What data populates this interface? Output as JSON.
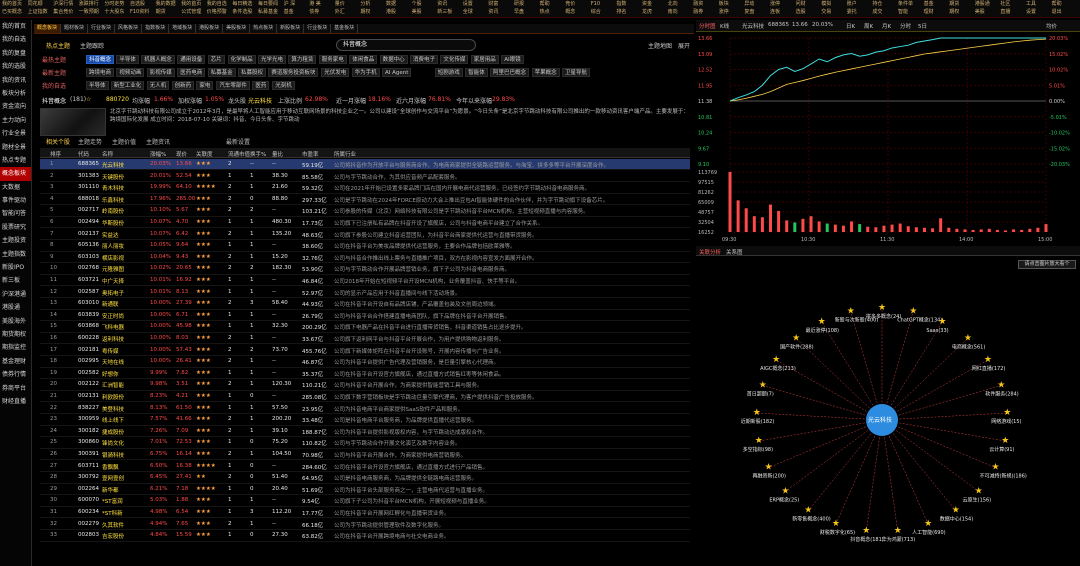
{
  "menu_items": [
    {
      "a": "我的首页",
      "b": "已买概念"
    },
    {
      "a": "同花顺",
      "b": "上证指数"
    },
    {
      "a": "沪深行情",
      "b": "集合竞价"
    },
    {
      "a": "涨跌排行",
      "b": "一致预期"
    },
    {
      "a": "分时走势",
      "b": "十大股东"
    },
    {
      "a": "自选股",
      "b": "F10资料"
    },
    {
      "a": "我的数据",
      "b": "期货"
    },
    {
      "a": "我的首页",
      "b": "公式管理"
    },
    {
      "a": "我的自选",
      "b": "价格预警"
    },
    {
      "a": "每日精选",
      "b": "条件选股"
    },
    {
      "a": "每日要闻",
      "b": "私募基金"
    },
    {
      "a": "沪 深",
      "b": "基金"
    },
    {
      "a": "港 美",
      "b": "债券"
    },
    {
      "a": "量价",
      "b": "外汇"
    },
    {
      "a": "分析",
      "b": "期权"
    },
    {
      "a": "数据",
      "b": "港股"
    },
    {
      "a": "个股",
      "b": "美股"
    },
    {
      "a": "资讯",
      "b": "新三板"
    },
    {
      "a": "设置",
      "b": "全球"
    },
    {
      "a": "财富",
      "b": "资讯"
    },
    {
      "a": "研报",
      "b": "早盘"
    },
    {
      "a": "帮助",
      "b": "热点"
    },
    {
      "a": "竞价",
      "b": "概念"
    },
    {
      "a": "F10",
      "b": "综合"
    },
    {
      "a": "指数",
      "b": "排名"
    },
    {
      "a": "资金",
      "b": "龙虎"
    },
    {
      "a": "北向",
      "b": "南向"
    },
    {
      "a": "融资",
      "b": "融券"
    },
    {
      "a": "板块",
      "b": "涨停"
    },
    {
      "a": "异动",
      "b": "复盘"
    },
    {
      "a": "涨停",
      "b": "连板"
    },
    {
      "a": "问财",
      "b": "选股"
    },
    {
      "a": "模拟",
      "b": "交易"
    },
    {
      "a": "账户",
      "b": "委托"
    },
    {
      "a": "持仓",
      "b": "成交"
    },
    {
      "a": "条件单",
      "b": "智能"
    },
    {
      "a": "基金",
      "b": "理财"
    },
    {
      "a": "期货",
      "b": "期权"
    },
    {
      "a": "港股通",
      "b": "美股"
    },
    {
      "a": "社区",
      "b": "直播"
    },
    {
      "a": "工具",
      "b": "设置"
    },
    {
      "a": "帮助",
      "b": "退出"
    }
  ],
  "left_nav": [
    "我的首页",
    "我的自选",
    "我的复盘",
    "我的选股",
    "我的资讯",
    "板块分析",
    "资金流向",
    "主力动向",
    "行业全景",
    "题材全景",
    "热点专题",
    "概念板块",
    "大数据",
    "事件驱动",
    "智能问答",
    "股票研究",
    "主题投资",
    "主题指数",
    "新股IPO",
    "新三板",
    "沪深港通",
    "港股通",
    "美股海外",
    "期货期权",
    "期指监控",
    "基金理财",
    "债券行情",
    "券商平台",
    "财经直播"
  ],
  "top_tabs": [
    "概念板块",
    "题材板块",
    "行业板块",
    "风格板块",
    "指数板块",
    "地域板块",
    "港股板块",
    "美股板块",
    "热点板块",
    "新股板块",
    "行业板块",
    "基金板块"
  ],
  "hot_row": {
    "hot": "热点主题",
    "theme": "主题跟踪",
    "search": "抖音概念",
    "right1": "主题地图",
    "right2": "展开"
  },
  "concept_rows": [
    {
      "label": "最热主题",
      "tags": [
        "抖音概念",
        "半导体",
        "机器人概念",
        "通用设备",
        "芯片",
        "化学制品",
        "光学光电",
        "算力租赁",
        "服务家电",
        "体闲食品",
        "数据中心",
        "消费电子",
        "文化传媒",
        "家居用品",
        "AI眼镜"
      ]
    },
    {
      "label": "最新主题",
      "tags": [
        "跨境电商",
        "视频动画",
        "影视传媒",
        "医药电商",
        "私募基金",
        "私募股权",
        "赛道服务投资板块",
        "光伏发电",
        "华为手机",
        "AI Agent",
        "短剧游戏",
        "智能体",
        "阿里巴巴概念",
        "苹果概念",
        "卫星导航"
      ]
    },
    {
      "label": "我的自选",
      "tags": [
        "半导体",
        "新型工业化",
        "无人机",
        "创新药",
        "家电",
        "汽车零部件",
        "医药",
        "光刻机"
      ]
    }
  ],
  "info": {
    "name": "抖音概念",
    "count": "(181)",
    "star": "☆",
    "index": "880720",
    "change_lab": "均涨幅",
    "change": "1.66%",
    "speed_lab": "加权涨幅",
    "speed": "1.05%",
    "leader_lab": "龙头股",
    "leader": "光云科技",
    "up_lab": "上涨比例",
    "up": "62.98%",
    "d5_lab": "近一月涨幅",
    "d5": "18.16%",
    "m6_lab": "近六月涨幅",
    "m6": "76.81%",
    "y_lab": "今年以来涨幅",
    "y": "29.83%"
  },
  "desc": "北京字节跳动科技有限公司成立于2012年3月，是最早将人工智能应用于移动互联网场景的科技企业之一。公司以建设“全球创作与交流平台”为愿景。“今日头条”是北京字节跳动科技有限公司推出的一款移动资讯客户端产品。主要发展于：跨境国际化发展 成立时间：2018-07-10 关键词：抖音、今日头条、字节跳动",
  "sub_tabs": [
    "相关个股",
    "主题走势",
    "主题价值",
    "主题资讯",
    "最新设置"
  ],
  "columns": [
    "排序",
    "代码",
    "名称",
    "涨幅%",
    "现价",
    "关联度",
    "流通市值",
    "换手%",
    "量比",
    "市盈率",
    "所属行业",
    "关联理由"
  ],
  "rows": [
    [
      "1",
      "688365",
      "光云科技",
      "20.03%",
      "13.66",
      "★★★",
      "2",
      "--",
      "--",
      "59.19亿",
      "公司将抖音作为开放平台与服务商合作，为电商商家提供全链路运营服务。与淘宝、拼多多等平台开展深度合作。"
    ],
    [
      "2",
      "301383",
      "天键股份",
      "20.01%",
      "52.54",
      "★★★",
      "1",
      "1",
      "38.30",
      "85.58亿",
      "公司与字节跳动合作，为其供应音频产品配套服务。"
    ],
    [
      "3",
      "301110",
      "青木科技",
      "19.99%",
      "64.10",
      "★★★★",
      "2",
      "1",
      "21.60",
      "59.32亿",
      "公司在2021年开始已设置多家品牌门店在国内开展电商代运营服务，已经签约字节跳动抖音电商服务商。"
    ],
    [
      "4",
      "688018",
      "乐鑫科技",
      "17.96%",
      "265.00",
      "★★★",
      "2",
      "0",
      "88.80",
      "297.33亿",
      "公司是字节跳动在2024年FORCE原动力大会上推出豆包AI智能体硬件的合作伙伴，并为字节跳动旗下设备芯片。"
    ],
    [
      "5",
      "002717",
      "岭南股份",
      "10.10%",
      "5.67",
      "★★★",
      "2",
      "2",
      "--",
      "103.21亿",
      "公司参股的传媒（北京）网络科技有限公司是字节跳动抖音平台MCN机构，主营短视频直播与内容服务。"
    ],
    [
      "6",
      "002494",
      "华斯股份",
      "10.07%",
      "4.70",
      "★★★",
      "1",
      "1",
      "480.30",
      "17.73亿",
      "公司旗下已注册私有品牌在抖音开设了旗舰店，公司与抖音电商平台建立了合作关系。"
    ],
    [
      "7",
      "002137",
      "实益达",
      "10.07%",
      "6.42",
      "★★★",
      "2",
      "1",
      "135.20",
      "48.63亿",
      "公司旗下参股公司建立抖音运营团队，为抖音平台商家提供代运营与直播带货服务。"
    ],
    [
      "8",
      "605136",
      "丽人丽妆",
      "10.05%",
      "9.64",
      "★★★",
      "1",
      "1",
      "--",
      "38.60亿",
      "公司在抖音平台为美妆品牌提供代运营服务，主要合作品牌包括欧莱雅等。"
    ],
    [
      "9",
      "603103",
      "横店影视",
      "10.04%",
      "9.43",
      "★★★",
      "2",
      "1",
      "15.20",
      "32.76亿",
      "公司与抖音合作推出线上票务与直播推广项目，双方在影视内容宣发方面展开合作。"
    ],
    [
      "10",
      "002768",
      "元隆雅图",
      "10.02%",
      "20.65",
      "★★★",
      "2",
      "2",
      "182.30",
      "53.90亿",
      "公司与字节跳动合作开展品牌营销业务，旗下子公司为抖音电商服务商。"
    ],
    [
      "11",
      "603721",
      "中广天择",
      "10.01%",
      "16.92",
      "★★★",
      "1",
      "1",
      "--",
      "46.84亿",
      "公司2018年开始在短视频平台开设MCN机构，业务覆盖抖音、快手等平台。"
    ],
    [
      "12",
      "002587",
      "奥拓电子",
      "10.01%",
      "8.13",
      "★★★",
      "1",
      "1",
      "--",
      "52.97亿",
      "公司的显示产品应用于抖音直播间与线下活动场景。"
    ],
    [
      "13",
      "603010",
      "新通联",
      "10.00%",
      "27.39",
      "★★★",
      "2",
      "3",
      "58.40",
      "44.93亿",
      "公司在抖音平台开设自有品牌店铺，产品覆盖包装及文创周边领域。"
    ],
    [
      "14",
      "603839",
      "安正时尚",
      "10.00%",
      "6.71",
      "★★★",
      "1",
      "1",
      "--",
      "26.79亿",
      "公司与抖音平台合作搭建直播电商团队，旗下品牌在抖音平台开展销售。"
    ],
    [
      "15",
      "603868",
      "飞科电器",
      "10.00%",
      "45.98",
      "★★★",
      "1",
      "1",
      "32.30",
      "200.29亿",
      "公司旗下电器产品在抖音平台进行直播带货销售，抖音渠道销售占比逐步提升。"
    ],
    [
      "16",
      "600228",
      "返利科技",
      "10.00%",
      "8.03",
      "★★★",
      "2",
      "1",
      "--",
      "33.67亿",
      "公司旗下返利网平台与抖音平台开展合作，为用户提供购物返利服务。"
    ],
    [
      "17",
      "002181",
      "粤传媒",
      "10.00%",
      "57.43",
      "★★★",
      "2",
      "2",
      "73.70",
      "455.76亿",
      "公司旗下新媒体矩阵在抖音平台开设账号，开展内容传播与广告业务。"
    ],
    [
      "18",
      "002995",
      "天地在线",
      "10.00%",
      "26.41",
      "★★★",
      "2",
      "1",
      "--",
      "46.87亿",
      "公司为抖音平台提供广告代理及营销服务，是巨量引擎核心代理商。"
    ],
    [
      "19",
      "002582",
      "好想你",
      "9.99%",
      "7.82",
      "★★★",
      "1",
      "1",
      "--",
      "35.37亿",
      "公司在抖音平台开设官方旗舰店，通过直播方式销售红枣等休闲食品。"
    ],
    [
      "20",
      "002122",
      "汇洲智能",
      "9.98%",
      "3.51",
      "★★★",
      "2",
      "1",
      "120.30",
      "110.21亿",
      "公司与抖音平台开展合作，为商家提供智能营销工具与服务。"
    ],
    [
      "21",
      "002131",
      "利欧股份",
      "8.23%",
      "4.21",
      "★★★",
      "1",
      "0",
      "--",
      "285.08亿",
      "公司旗下数字营销板块是字节跳动巨量引擎代理商，为客户提供抖音广告投放服务。"
    ],
    [
      "22",
      "838227",
      "美登科技",
      "8.13%",
      "61.50",
      "★★★",
      "1",
      "1",
      "57.50",
      "23.95亿",
      "公司为抖音电商平台商家提供SaaS软件产品和服务。"
    ],
    [
      "23",
      "300959",
      "线上线下",
      "7.57%",
      "41.66",
      "★★★",
      "2",
      "1",
      "200.20",
      "33.48亿",
      "公司是抖音电商平台服务商，为品牌提供直播代运营服务。"
    ],
    [
      "24",
      "300182",
      "捷成股份",
      "7.26%",
      "7.09",
      "★★★",
      "2",
      "1",
      "39.10",
      "188.87亿",
      "公司为抖音平台提供影视版权内容，与字节跳动达成版权合作。"
    ],
    [
      "25",
      "300860",
      "锋尚文化",
      "7.01%",
      "72.53",
      "★★★",
      "1",
      "0",
      "75.20",
      "110.82亿",
      "公司与字节跳动合作开展文化演艺及数字内容业务。"
    ],
    [
      "26",
      "300391",
      "银骑科技",
      "6.75%",
      "16.14",
      "★★★",
      "2",
      "1",
      "104.50",
      "70.98亿",
      "公司与抖音平台开展合作，为商家提供电商营销服务。"
    ],
    [
      "27",
      "603711",
      "香飘飘",
      "6.50%",
      "16.38",
      "★★★★",
      "1",
      "0",
      "--",
      "284.60亿",
      "公司在抖音平台开设官方旗舰店，通过直播方式进行产品销售。"
    ],
    [
      "28",
      "300792",
      "壹网壹创",
      "6.45%",
      "27.41",
      "★★",
      "2",
      "0",
      "51.40",
      "64.95亿",
      "公司是抖音电商服务商，为品牌提供全链路电商运营服务。"
    ],
    [
      "29",
      "002264",
      "新华都",
      "6.21%",
      "7.18",
      "★★★★",
      "1",
      "0",
      "20.40",
      "51.69亿",
      "公司为抖音平台头部服务商之一，主营电商代运营与直播业务。"
    ],
    [
      "30",
      "600070",
      "*ST富润",
      "5.03%",
      "1.88",
      "★★★",
      "1",
      "1",
      "--",
      "9.54亿",
      "公司旗下子公司为抖音平台MCN机构，开展短视频与直播业务。"
    ],
    [
      "31",
      "600234",
      "*ST科新",
      "4.98%",
      "6.54",
      "★★★",
      "1",
      "3",
      "112.20",
      "17.77亿",
      "公司在抖音平台开展网红孵化与直播带货业务。"
    ],
    [
      "32",
      "002279",
      "久其软件",
      "4.94%",
      "7.65",
      "★★★",
      "2",
      "1",
      "--",
      "66.18亿",
      "公司为字节跳动提供管理软件及数字化服务。"
    ],
    [
      "33",
      "002803",
      "吉宏股份",
      "4.84%",
      "15.59",
      "★★★",
      "1",
      "0",
      "27.30",
      "63.82亿",
      "公司在抖音平台开展跨境电商与社交电商业务。"
    ]
  ],
  "kchart": {
    "tab1": "分时图",
    "tab2": "K线",
    "title": "光云科技",
    "code": "688365",
    "price": "13.66",
    "chg": "20.03%",
    "tabs": [
      "日K",
      "周K",
      "月K",
      "分时",
      "5日"
    ],
    "tag_right": "均价",
    "y_labels": [
      "13.66",
      "13.09",
      "12.52",
      "11.95",
      "11.38",
      "10.81",
      "10.24",
      "9.67",
      "9.10"
    ],
    "pct_labels": [
      "20.03%",
      "15.02%",
      "10.02%",
      "5.01%",
      "0.00%",
      "-5.01%",
      "-10.02%",
      "-15.02%",
      "-20.03%"
    ],
    "vol_labels": [
      "113769",
      "97515",
      "81262",
      "65009",
      "48757",
      "32504",
      "16252"
    ],
    "time_labels": [
      "09:30",
      "10:30",
      "11:30",
      "14:00",
      "15:00"
    ],
    "price_series": [
      11.38,
      11.5,
      11.6,
      11.72,
      11.95,
      12.3,
      12.52,
      12.6,
      12.45,
      12.55,
      12.72,
      12.9,
      12.8,
      12.95,
      13.05,
      13.1,
      13.0,
      13.05,
      13.15,
      13.2,
      13.3,
      13.35,
      13.4,
      13.5,
      13.55,
      13.6,
      13.66,
      13.66,
      13.66,
      13.66,
      13.66,
      13.66,
      13.66,
      13.66,
      13.66,
      13.66,
      13.66,
      13.66,
      13.66,
      13.66
    ],
    "avg_series": [
      11.38,
      11.42,
      11.48,
      11.55,
      11.62,
      11.72,
      11.85,
      11.98,
      12.05,
      12.12,
      12.2,
      12.28,
      12.35,
      12.42,
      12.48,
      12.54,
      12.6,
      12.66,
      12.72,
      12.78,
      12.84,
      12.9,
      12.96,
      13.02,
      13.08,
      13.12,
      13.16,
      13.2,
      13.24,
      13.28,
      13.32,
      13.36,
      13.4,
      13.44,
      13.48,
      13.52,
      13.55,
      13.58,
      13.6,
      13.62
    ],
    "vol_series": [
      113769,
      60000,
      45000,
      30000,
      28000,
      52000,
      40000,
      22000,
      18000,
      25000,
      30000,
      20000,
      16000,
      14000,
      12000,
      20000,
      15000,
      10000,
      9000,
      12000,
      14000,
      16000,
      11000,
      9000,
      8000,
      7000,
      26000,
      8000,
      6000,
      5000,
      4000,
      5000,
      6000,
      4000,
      3000,
      5000,
      4000,
      6000,
      8000,
      15000
    ]
  },
  "graph": {
    "tab1": "关联分析",
    "tab2": "关系图",
    "button": "请点击图片放大看个",
    "center": "光云科技",
    "nodes": [
      {
        "label": "拼多多概念(24)"
      },
      {
        "label": "ChatGPT概念(134)"
      },
      {
        "label": "Saas(33)"
      },
      {
        "label": "电商概念(561)"
      },
      {
        "label": "网红直播(172)"
      },
      {
        "label": "软件服务(284)"
      },
      {
        "label": "网络游戏(15)"
      },
      {
        "label": "云计算(91)"
      },
      {
        "label": "不可减持(新规)(186)"
      },
      {
        "label": "云原生(156)"
      },
      {
        "label": "数据中心(154)"
      },
      {
        "label": "人工智能(690)"
      },
      {
        "label": "华为鸿蒙(713)"
      },
      {
        "label": "抖音概念(181)"
      },
      {
        "label": "财税数字化(65)"
      },
      {
        "label": "新零售概念(400)"
      },
      {
        "label": "ERP概念(25)"
      },
      {
        "label": "再融资新(200)"
      },
      {
        "label": "多空指标(98)"
      },
      {
        "label": "近期新股(182)"
      },
      {
        "label": "首日超额(7)"
      },
      {
        "label": "AIGC概念(213)"
      },
      {
        "label": "国产软件(288)"
      },
      {
        "label": "最近涨停(108)"
      },
      {
        "label": "新股与次新股(400)"
      }
    ]
  },
  "colors": {
    "up": "#ff4a4a",
    "down": "#22c55e",
    "accent": "#ffd24a",
    "select": "#1448a8",
    "graph_center": "#2d8ce0",
    "star": "#f5c518",
    "edge": "#d04040"
  }
}
